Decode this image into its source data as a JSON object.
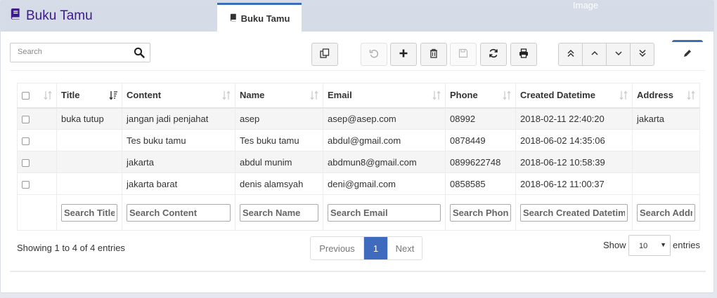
{
  "header": {
    "title": "Buku Tamu",
    "tab_label": "Buku Tamu",
    "ghost_text": "Image"
  },
  "toolbar": {
    "search_placeholder": "Search",
    "buttons": [
      "copy-icon",
      "undo-icon",
      "plus-icon",
      "trash-icon",
      "save-icon",
      "refresh-icon",
      "print-icon"
    ],
    "nav_buttons": [
      "double-up-icon",
      "up-icon",
      "down-icon",
      "double-down-icon"
    ],
    "edit_icon": "pencil-icon"
  },
  "table": {
    "columns": [
      "Title",
      "Content",
      "Name",
      "Email",
      "Phone",
      "Created Datetime",
      "Address"
    ],
    "rows": [
      {
        "title": "buka tutup",
        "content": "jangan jadi penjahat",
        "name": "asep",
        "email": "asep@asep.com",
        "phone": "08992",
        "created": "2018-02-11 22:40:20",
        "address": "jakarta"
      },
      {
        "title": "",
        "content": "Tes buku tamu",
        "name": "Tes buku tamu",
        "email": "abdul@gmail.com",
        "phone": "0878449",
        "created": "2018-06-02 14:35:06",
        "address": ""
      },
      {
        "title": "",
        "content": "jakarta",
        "name": "abdul munim",
        "email": "abdmun8@gmail.com",
        "phone": "0899622748",
        "created": "2018-06-12 10:58:39",
        "address": ""
      },
      {
        "title": "",
        "content": "jakarta barat",
        "name": "denis alamsyah",
        "email": "deni@gmail.com",
        "phone": "0858585",
        "created": "2018-06-12 11:00:37",
        "address": ""
      }
    ],
    "search_placeholders": [
      "Search Title",
      "Search Content",
      "Search Name",
      "Search Email",
      "Search Phone",
      "Search Created Datetime",
      "Search Address"
    ]
  },
  "footer": {
    "info": "Showing 1 to 4 of 4 entries",
    "prev": "Previous",
    "page": "1",
    "next": "Next",
    "show_label": "Show",
    "page_size": "10",
    "entries_label": "entries"
  },
  "colors": {
    "header_bg": "#d6dce7",
    "title_color": "#3d1a8c",
    "accent": "#3f6bbf"
  }
}
